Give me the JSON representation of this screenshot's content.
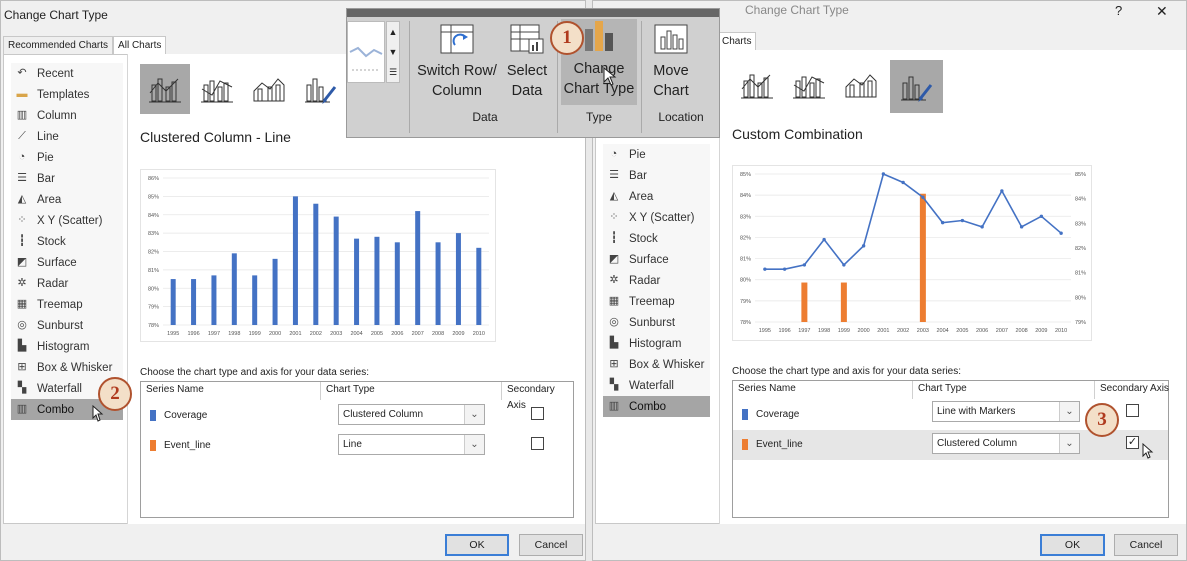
{
  "left_dialog": {
    "title": "Change Chart Type",
    "tabs": [
      "Recommended Charts",
      "All Charts"
    ],
    "categories": [
      "Recent",
      "Templates",
      "Column",
      "Line",
      "Pie",
      "Bar",
      "Area",
      "X Y (Scatter)",
      "Stock",
      "Surface",
      "Radar",
      "Treemap",
      "Sunburst",
      "Histogram",
      "Box & Whisker",
      "Waterfall",
      "Combo"
    ],
    "selected_category": "Combo",
    "chart_title": "Clustered Column - Line",
    "series_prompt": "Choose the chart type and axis for your data series:",
    "headers": {
      "series": "Series Name",
      "type": "Chart Type",
      "axis": "Secondary Axis"
    },
    "series": [
      {
        "name": "Coverage",
        "color": "#4472c4",
        "type": "Clustered Column",
        "secondary": false
      },
      {
        "name": "Event_line",
        "color": "#ed7d31",
        "type": "Line",
        "secondary": false
      }
    ],
    "ok": "OK",
    "cancel": "Cancel"
  },
  "right_dialog": {
    "title_partial": "Change Chart Type",
    "help": "?",
    "close": "✕",
    "tab": "Charts",
    "categories": [
      "Pie",
      "Bar",
      "Area",
      "X Y (Scatter)",
      "Stock",
      "Surface",
      "Radar",
      "Treemap",
      "Sunburst",
      "Histogram",
      "Box & Whisker",
      "Waterfall",
      "Combo"
    ],
    "selected_category": "Combo",
    "chart_title": "Custom Combination",
    "series_prompt": "Choose the chart type and axis for your data series:",
    "headers": {
      "series": "Series Name",
      "type": "Chart Type",
      "axis": "Secondary Axis"
    },
    "series": [
      {
        "name": "Coverage",
        "color": "#4472c4",
        "type": "Line with Markers",
        "secondary": false
      },
      {
        "name": "Event_line",
        "color": "#ed7d31",
        "type": "Clustered Column",
        "secondary": true
      }
    ],
    "ok": "OK",
    "cancel": "Cancel"
  },
  "ribbon": {
    "buttons": [
      {
        "label1": "Switch Row/",
        "label2": "Column"
      },
      {
        "label1": "Select",
        "label2": "Data"
      },
      {
        "label1": "Change",
        "label2": "Chart Type"
      },
      {
        "label1": "Move",
        "label2": "Chart"
      }
    ],
    "groups": [
      "Data",
      "Type",
      "Location"
    ]
  },
  "badges": [
    "1",
    "2",
    "3"
  ],
  "chart_data": [
    {
      "type": "bar",
      "categories": [
        "1995",
        "1996",
        "1997",
        "1998",
        "1999",
        "2000",
        "2001",
        "2002",
        "2003",
        "2004",
        "2005",
        "2006",
        "2007",
        "2008",
        "2009",
        "2010"
      ],
      "series": [
        {
          "name": "Coverage",
          "values": [
            80.5,
            80.5,
            80.7,
            81.9,
            80.7,
            81.6,
            85.0,
            84.6,
            83.9,
            82.7,
            82.8,
            82.5,
            84.2,
            82.5,
            83.0,
            82.2
          ],
          "color": "#4472c4"
        }
      ],
      "y_ticks": [
        "78%",
        "79%",
        "80%",
        "81%",
        "82%",
        "83%",
        "84%",
        "85%",
        "86%"
      ],
      "ylim": [
        78,
        86
      ]
    },
    {
      "type": "line",
      "categories": [
        "1995",
        "1996",
        "1997",
        "1998",
        "1999",
        "2000",
        "2001",
        "2002",
        "2003",
        "2004",
        "2005",
        "2006",
        "2007",
        "2008",
        "2009",
        "2010"
      ],
      "series": [
        {
          "name": "Coverage",
          "type": "line",
          "values": [
            80.5,
            80.5,
            80.7,
            81.9,
            80.7,
            81.6,
            85.0,
            84.6,
            83.9,
            82.7,
            82.8,
            82.5,
            84.2,
            82.5,
            83.0,
            82.2
          ],
          "color": "#4472c4"
        },
        {
          "name": "Event_line",
          "type": "bar",
          "axis": "secondary",
          "values": [
            79,
            79,
            80.6,
            79,
            80.6,
            79,
            79,
            79,
            84.2,
            79,
            79,
            79,
            79,
            79,
            79,
            79
          ],
          "color": "#ed7d31"
        }
      ],
      "y_ticks": [
        "78%",
        "79%",
        "80%",
        "81%",
        "82%",
        "83%",
        "84%",
        "85%"
      ],
      "ylim": [
        78,
        85
      ],
      "y2_ticks": [
        "79%",
        "80%",
        "81%",
        "82%",
        "83%",
        "84%",
        "85%"
      ],
      "y2lim": [
        79,
        85
      ]
    }
  ]
}
